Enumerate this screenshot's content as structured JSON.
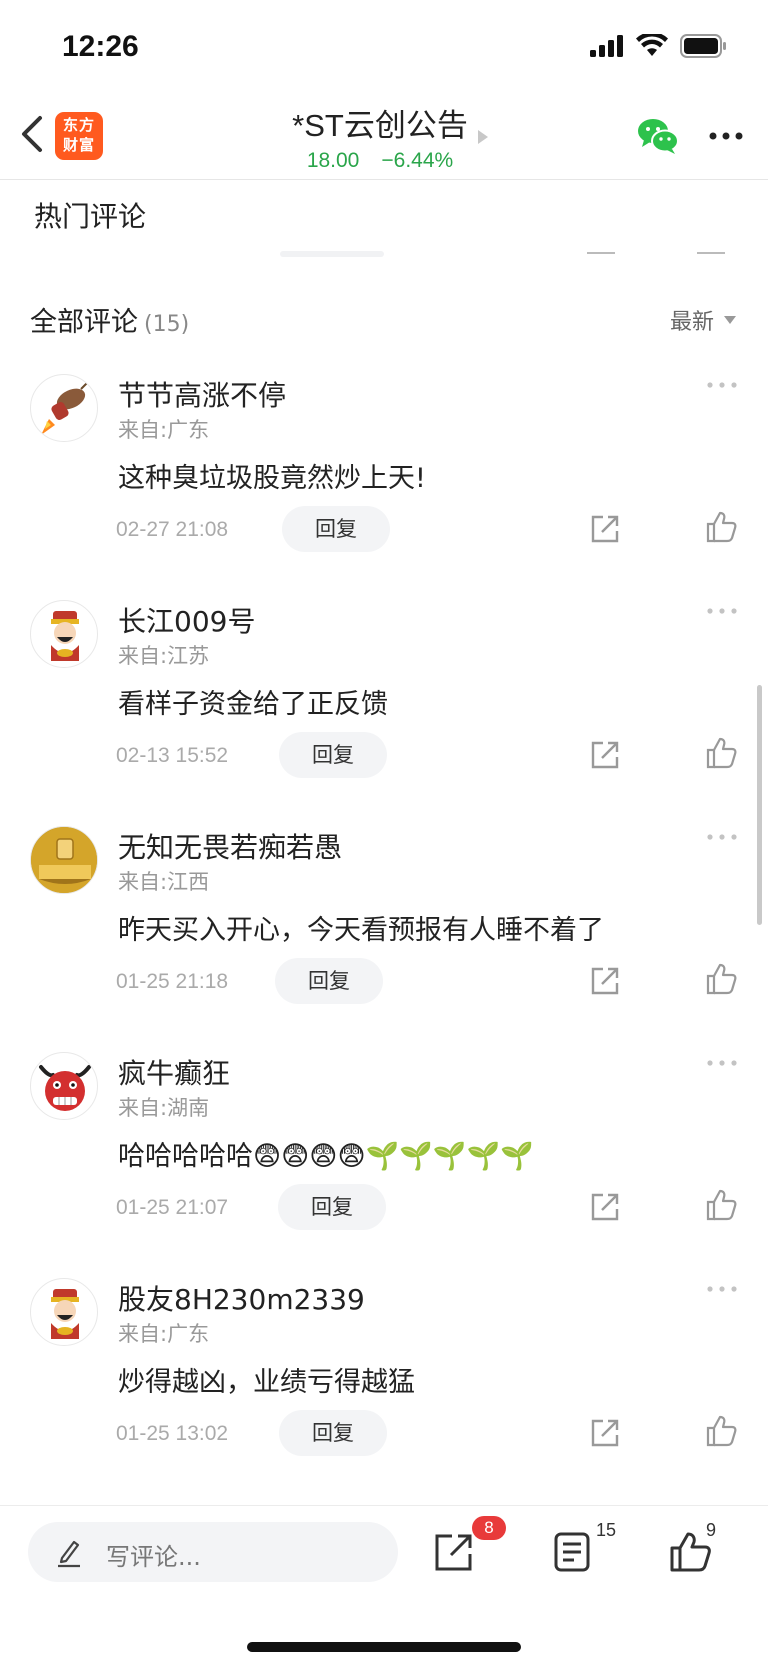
{
  "status_bar": {
    "time": "12:26"
  },
  "header": {
    "logo_line1": "东方",
    "logo_line2": "财富",
    "title": "*ST云创公告",
    "price": "18.00",
    "change": "−6.44%"
  },
  "hot_section": {
    "title": "热门评论"
  },
  "all_section": {
    "title": "全部评论",
    "count": "(15)",
    "sort_label": "最新"
  },
  "comments": [
    {
      "name": "节节高涨不停",
      "location": "来自:广东",
      "text": "这种臭垃圾股竟然炒上天!",
      "time": "02-27 21:08",
      "reply_label": "回复",
      "avatar_icon": "rocket-bull-avatar"
    },
    {
      "name": "长江009号",
      "location": "来自:江苏",
      "text": "看样子资金给了正反馈",
      "time": "02-13 15:52",
      "reply_label": "回复",
      "avatar_icon": "fortune-god-avatar"
    },
    {
      "name": "无知无畏若痴若愚",
      "location": "来自:江西",
      "text": "昨天买入开心，今天看预报有人睡不着了",
      "time": "01-25 21:18",
      "reply_label": "回复",
      "avatar_icon": "gold-coin-avatar"
    },
    {
      "name": "疯牛癫狂",
      "location": "来自:湖南",
      "text": "哈哈哈哈哈😨😨😨😨🌱🌱🌱🌱🌱",
      "time": "01-25 21:07",
      "reply_label": "回复",
      "avatar_icon": "red-bull-avatar"
    },
    {
      "name": "股友8H230m2339",
      "location": "来自:广东",
      "text": "炒得越凶，业绩亏得越猛",
      "time": "01-25 13:02",
      "reply_label": "回复",
      "avatar_icon": "fortune-god-avatar"
    }
  ],
  "bottom_bar": {
    "write_placeholder": "写评论...",
    "share_badge": "8",
    "comment_count": "15",
    "like_count": "9"
  },
  "colors": {
    "accent_green": "#2aa54a",
    "logo_orange": "#ff5a1f",
    "badge_red": "#e83a3a",
    "wechat_green": "#2dc24c"
  }
}
